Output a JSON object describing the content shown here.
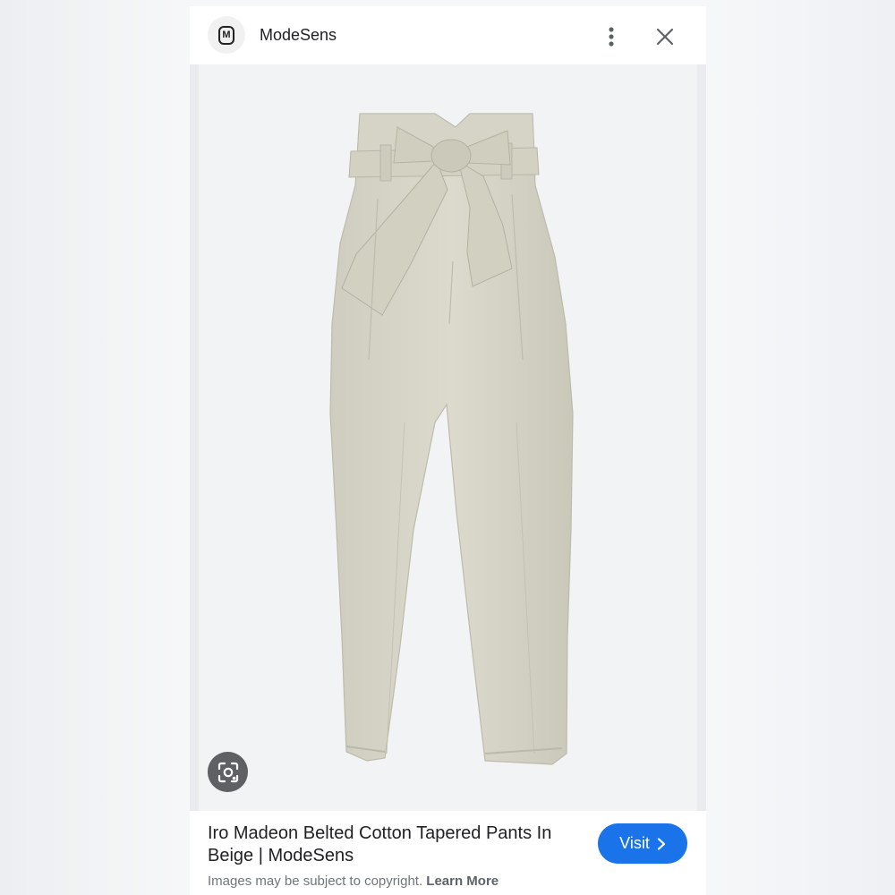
{
  "header": {
    "site_name": "ModeSens",
    "logo_letter": "M",
    "icons": {
      "more": "more-vert-icon",
      "close": "close-icon"
    }
  },
  "image": {
    "icons": {
      "lens": "lens-search-icon"
    },
    "colors": {
      "fabric": "#d9d7c9",
      "fabric_shadow": "#c6c4b4",
      "background": "#f2f3f5"
    }
  },
  "caption": {
    "title": "Iro Madeon Belted Cotton Tapered Pants In Beige | ModeSens",
    "copyright": "Images may be subject to copyright.",
    "learn_more": "Learn More",
    "visit_label": "Visit",
    "visit_icon": "chevron-right-icon"
  },
  "colors": {
    "accent": "#1a73e8",
    "text": "#202124",
    "muted": "#70757a"
  }
}
